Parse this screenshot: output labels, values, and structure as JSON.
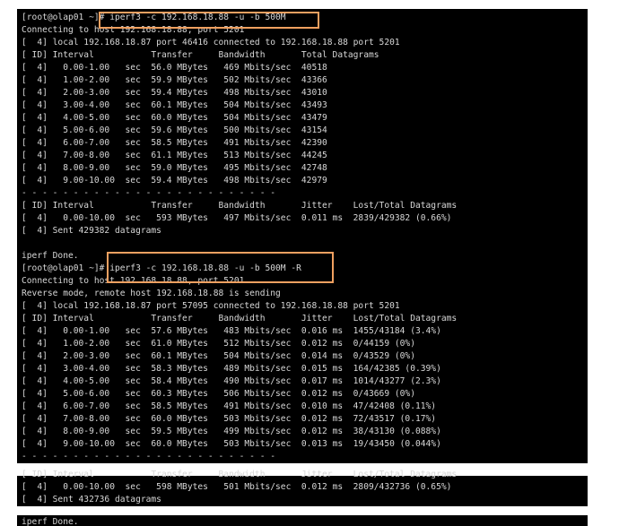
{
  "terminal": {
    "lines": [
      "[root@olap01 ~]# iperf3 -c 192.168.18.88 -u -b 500M",
      "Connecting to host 192.168.18.88, port 5201",
      "[  4] local 192.168.18.87 port 46416 connected to 192.168.18.88 port 5201",
      "[ ID] Interval           Transfer     Bandwidth       Total Datagrams",
      "[  4]   0.00-1.00   sec  56.0 MBytes   469 Mbits/sec  40518",
      "[  4]   1.00-2.00   sec  59.9 MBytes   502 Mbits/sec  43366",
      "[  4]   2.00-3.00   sec  59.4 MBytes   498 Mbits/sec  43010",
      "[  4]   3.00-4.00   sec  60.1 MBytes   504 Mbits/sec  43493",
      "[  4]   4.00-5.00   sec  60.0 MBytes   504 Mbits/sec  43479",
      "[  4]   5.00-6.00   sec  59.6 MBytes   500 Mbits/sec  43154",
      "[  4]   6.00-7.00   sec  58.5 MBytes   491 Mbits/sec  42390",
      "[  4]   7.00-8.00   sec  61.1 MBytes   513 Mbits/sec  44245",
      "[  4]   8.00-9.00   sec  59.0 MBytes   495 Mbits/sec  42748",
      "[  4]   9.00-10.00  sec  59.4 MBytes   498 Mbits/sec  42979",
      "- - - - - - - - - - - - - - - - - - - - - - - - -",
      "[ ID] Interval           Transfer     Bandwidth       Jitter    Lost/Total Datagrams",
      "[  4]   0.00-10.00  sec   593 MBytes   497 Mbits/sec  0.011 ms  2839/429382 (0.66%)",
      "[  4] Sent 429382 datagrams",
      "",
      "iperf Done.",
      "[root@olap01 ~]# iperf3 -c 192.168.18.88 -u -b 500M -R",
      "Connecting to host 192.168.18.88, port 5201",
      "Reverse mode, remote host 192.168.18.88 is sending",
      "[  4] local 192.168.18.87 port 57095 connected to 192.168.18.88 port 5201",
      "[ ID] Interval           Transfer     Bandwidth       Jitter    Lost/Total Datagrams",
      "[  4]   0.00-1.00   sec  57.6 MBytes   483 Mbits/sec  0.016 ms  1455/43184 (3.4%)",
      "[  4]   1.00-2.00   sec  61.0 MBytes   512 Mbits/sec  0.012 ms  0/44159 (0%)",
      "[  4]   2.00-3.00   sec  60.1 MBytes   504 Mbits/sec  0.014 ms  0/43529 (0%)",
      "[  4]   3.00-4.00   sec  58.3 MBytes   489 Mbits/sec  0.015 ms  164/42385 (0.39%)",
      "[  4]   4.00-5.00   sec  58.4 MBytes   490 Mbits/sec  0.017 ms  1014/43277 (2.3%)",
      "[  4]   5.00-6.00   sec  60.3 MBytes   506 Mbits/sec  0.012 ms  0/43669 (0%)",
      "[  4]   6.00-7.00   sec  58.5 MBytes   491 Mbits/sec  0.010 ms  47/42408 (0.11%)",
      "[  4]   7.00-8.00   sec  60.0 MBytes   503 Mbits/sec  0.012 ms  72/43517 (0.17%)",
      "[  4]   8.00-9.00   sec  59.5 MBytes   499 Mbits/sec  0.012 ms  38/43130 (0.088%)",
      "[  4]   9.00-10.00  sec  60.0 MBytes   503 Mbits/sec  0.013 ms  19/43450 (0.044%)",
      "- - - - - - - - - - - - - - - - - - - - - - - - -",
      "[ ID] Interval           Transfer     Bandwidth       Jitter    Lost/Total Datagrams",
      "[  4]   0.00-10.00  sec   598 MBytes   501 Mbits/sec  0.012 ms  2809/432736 (0.65%)",
      "[  4] Sent 432736 datagrams",
      "",
      "iperf Done."
    ]
  },
  "colors": {
    "terminal_bg": "#000000",
    "terminal_fg": "#d7d7d7",
    "highlight_box": "#f0a060"
  }
}
